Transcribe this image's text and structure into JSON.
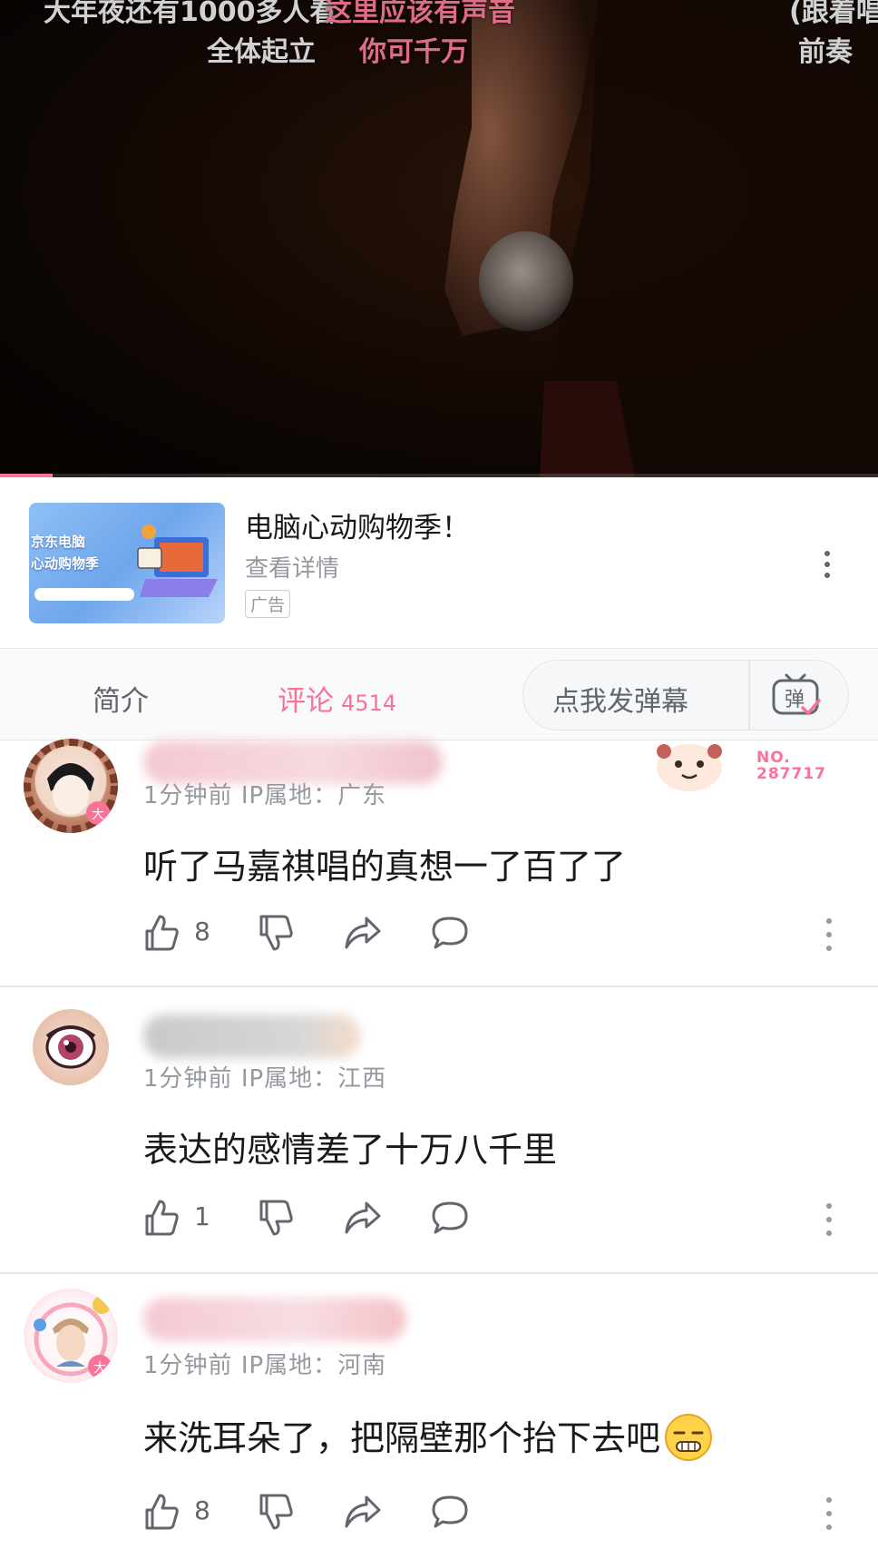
{
  "video": {
    "danmaku": [
      "大年夜还有1000多人看",
      "这里应该有声音",
      "全体起立",
      "你可千万",
      "(跟着唱)",
      "前奏"
    ],
    "progress": 0.06
  },
  "ad": {
    "thumb_line1": "京东电脑",
    "thumb_line2": "心动购物季",
    "title": "电脑心动购物季！",
    "link": "查看详情",
    "tag": "广告"
  },
  "tabs": {
    "intro": "简介",
    "comments": "评论",
    "comments_count": "4514",
    "danmaku_placeholder": "点我发弹幕",
    "danmaku_icon_label": "弹"
  },
  "comments": [
    {
      "time": "1分钟前",
      "ip": "IP属地：广东",
      "text": "听了马嘉祺唱的真想一了百了了",
      "likes": "8",
      "fan_badge": "NO.\n287717"
    },
    {
      "time": "1分钟前",
      "ip": "IP属地：江西",
      "text": "表达的感情差了十万八千里",
      "likes": "1"
    },
    {
      "time": "1分钟前",
      "ip": "IP属地：河南",
      "text": "来洗耳朵了，把隔壁那个抬下去吧",
      "likes": "8"
    }
  ],
  "colors": {
    "accent": "#fb7299",
    "text": "#18191c",
    "secondary": "#9499a0"
  }
}
